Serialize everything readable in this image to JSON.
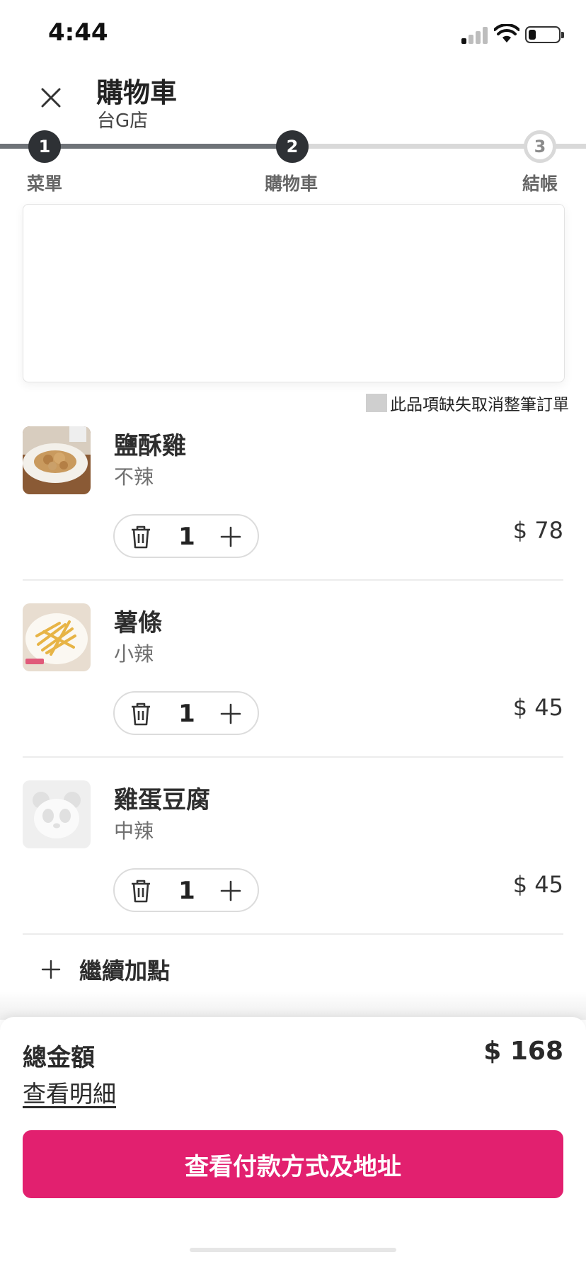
{
  "status_bar": {
    "time": "4:44"
  },
  "header": {
    "title": "購物車",
    "store": "台G店"
  },
  "stepper": {
    "steps": [
      {
        "number": "1",
        "label": "菜單"
      },
      {
        "number": "2",
        "label": "購物車"
      },
      {
        "number": "3",
        "label": "結帳"
      }
    ],
    "current_step": 2
  },
  "cancel_option": {
    "label": "此品項缺失取消整筆訂單"
  },
  "cart": {
    "items": [
      {
        "name": "鹽酥雞",
        "option": "不辣",
        "quantity": "1",
        "price": "$ 78"
      },
      {
        "name": "薯條",
        "option": "小辣",
        "quantity": "1",
        "price": "$ 45"
      },
      {
        "name": "雞蛋豆腐",
        "option": "中辣",
        "quantity": "1",
        "price": "$ 45"
      }
    ],
    "add_more_label": "繼續加點"
  },
  "summary": {
    "total_label": "總金額",
    "total_value": "$ 168",
    "details_link": "查看明細",
    "checkout_button": "查看付款方式及地址"
  },
  "colors": {
    "accent": "#e2206f",
    "step_active": "#2e3135",
    "step_pending": "#d9d9d9"
  }
}
